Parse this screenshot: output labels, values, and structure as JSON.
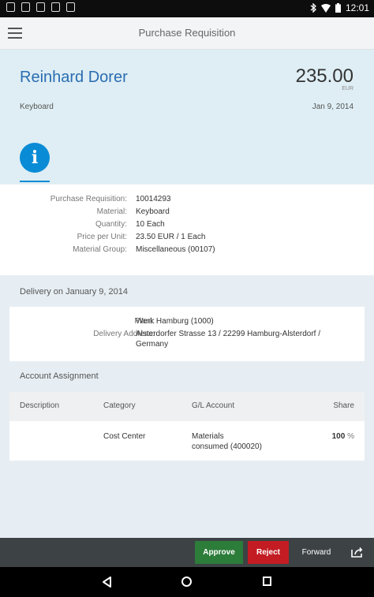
{
  "status_bar": {
    "time": "12:01",
    "icons": [
      "notification-icon",
      "sd-card-icon",
      "camera-icon",
      "usb-icon",
      "app-icon"
    ],
    "right_icons": [
      "bluetooth-icon",
      "wifi-icon",
      "battery-icon"
    ]
  },
  "app_bar": {
    "title": "Purchase Requisition"
  },
  "header": {
    "requester": "Reinhard Dorer",
    "amount": "235.00",
    "currency": "EUR",
    "item": "Keyboard",
    "date": "Jan 9, 2014"
  },
  "info_tab": {
    "icon": "info-icon",
    "glyph": "i",
    "color": "#0a8bd6"
  },
  "details": {
    "rows": [
      {
        "label": "Purchase Requisition:",
        "value": "10014293"
      },
      {
        "label": "Material:",
        "value": "Keyboard"
      },
      {
        "label": "Quantity:",
        "value": "10 Each"
      },
      {
        "label": "Price per Unit:",
        "value": "23.50 EUR / 1 Each"
      },
      {
        "label": "Material Group:",
        "value": "Miscellaneous (00107)"
      }
    ]
  },
  "delivery": {
    "title": "Delivery on January 9, 2014",
    "plant_label": "Plant:",
    "plant_value": "Werk Hamburg (1000)",
    "address_label": "Delivery Address:",
    "address_line1": "Alsterdorfer Strasse 13 / 22299 Hamburg-Alsterdorf /",
    "address_line2": "Germany"
  },
  "account": {
    "title": "Account Assignment",
    "headers": [
      "Description",
      "Category",
      "G/L Account",
      "Share"
    ],
    "row": {
      "description": "",
      "category": "Cost Center",
      "gl_line1": "Materials",
      "gl_line2": "consumed (400020)",
      "share_value": "100",
      "share_unit": "%"
    }
  },
  "footer": {
    "approve": "Approve",
    "reject": "Reject",
    "forward": "Forward",
    "share_icon": "share-icon",
    "approve_color": "#2c7c3a",
    "reject_color": "#c31c23"
  },
  "nav_bar": {
    "icons": [
      "back-icon",
      "home-icon",
      "recent-apps-icon"
    ]
  }
}
